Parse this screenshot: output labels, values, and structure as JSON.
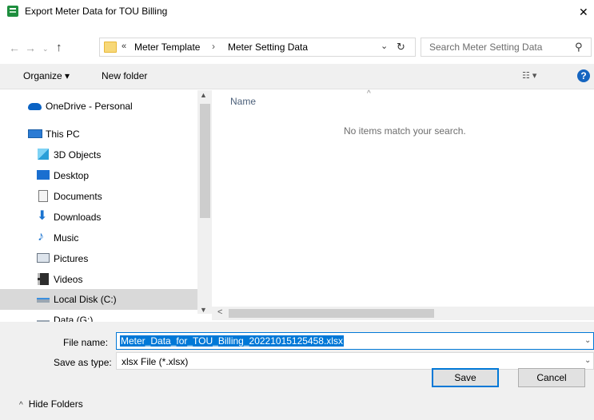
{
  "window": {
    "title": "Export Meter Data for TOU Billing",
    "close_glyph": "✕"
  },
  "address": {
    "back_glyph": "←",
    "forward_glyph": "→",
    "recent_glyph": "⌄",
    "up_glyph": "↑",
    "overflow": "«",
    "crumbs": [
      "Meter Template",
      "Meter Setting Data"
    ],
    "separator": "›",
    "dropdown_glyph": "⌄",
    "refresh_glyph": "↻"
  },
  "search": {
    "placeholder": "Search Meter Setting Data",
    "icon_glyph": "⚲"
  },
  "toolbar": {
    "organize_label": "Organize ▾",
    "new_folder_label": "New folder",
    "view_label": "☷ ▾",
    "help_label": "?"
  },
  "nav": {
    "items": [
      {
        "label": "OneDrive - Personal",
        "icon": "onedrive-icon"
      },
      {
        "label": "This PC",
        "icon": "computer-icon"
      },
      {
        "label": "3D Objects",
        "icon": "cube-icon"
      },
      {
        "label": "Desktop",
        "icon": "desktop-icon"
      },
      {
        "label": "Documents",
        "icon": "document-icon"
      },
      {
        "label": "Downloads",
        "icon": "download-icon"
      },
      {
        "label": "Music",
        "icon": "music-icon"
      },
      {
        "label": "Pictures",
        "icon": "pictures-icon"
      },
      {
        "label": "Videos",
        "icon": "videos-icon"
      },
      {
        "label": "Local Disk (C:)",
        "icon": "disk-icon"
      },
      {
        "label": "Data (G:)",
        "icon": "drive-icon"
      }
    ],
    "selected": "Local Disk (C:)",
    "scroll_up_glyph": "▲",
    "scroll_down_glyph": "▼"
  },
  "content": {
    "column_name": "Name",
    "sort_glyph": "^",
    "empty_message": "No items match your search.",
    "scroll_left_glyph": "<"
  },
  "form": {
    "file_name_label": "File name:",
    "file_name_value": "Meter_Data_for_TOU_Billing_20221015125458.xlsx",
    "save_type_label": "Save as type:",
    "save_type_value": "xlsx File (*.xlsx)",
    "dropdown_glyph": "⌄"
  },
  "footer": {
    "hide_folders_label": "Hide Folders",
    "hide_chevron": "^",
    "save_label": "Save",
    "cancel_label": "Cancel"
  }
}
